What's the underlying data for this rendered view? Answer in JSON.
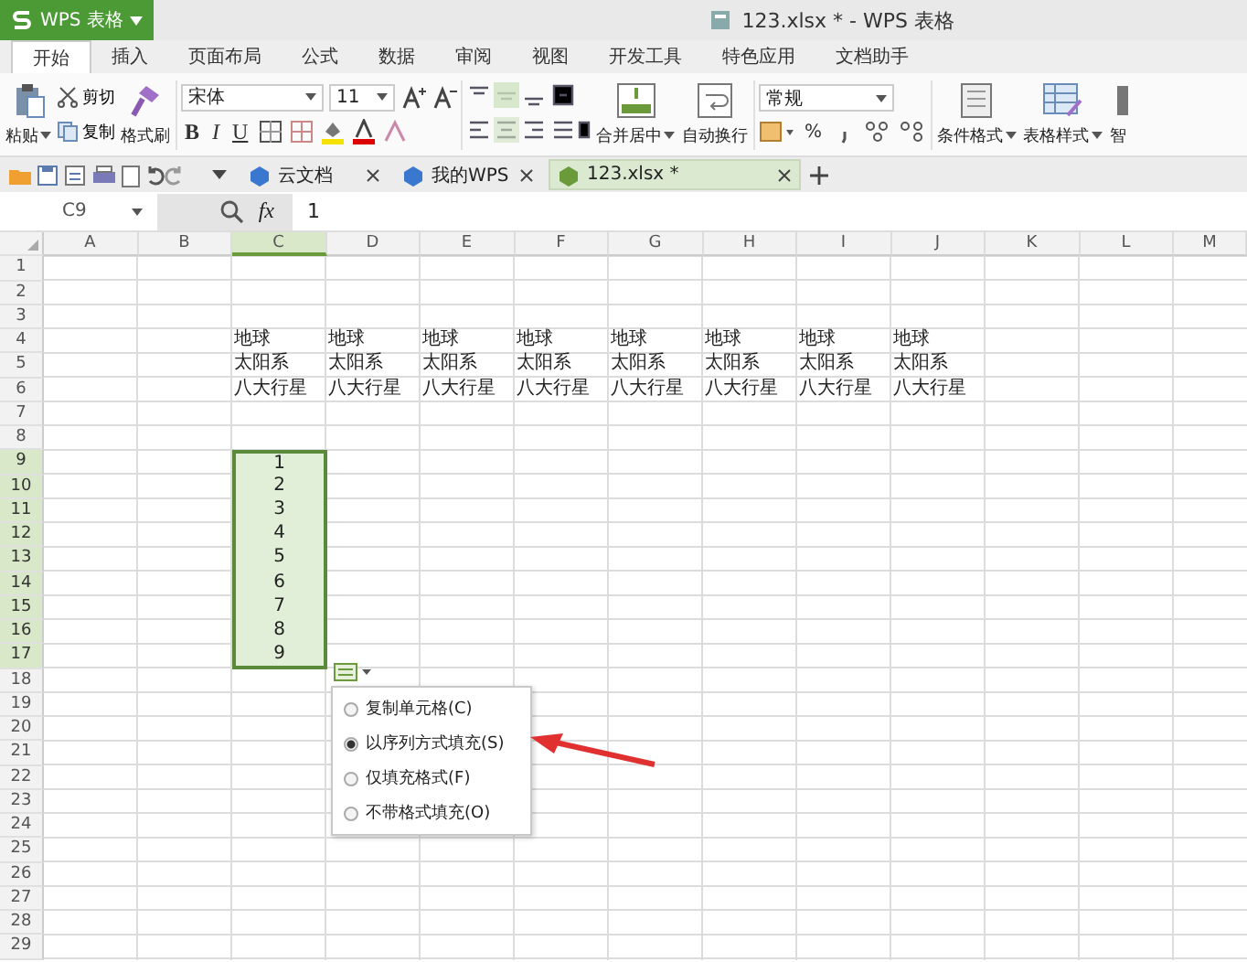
{
  "app_button": {
    "label": "WPS 表格"
  },
  "window": {
    "title": "123.xlsx * - WPS 表格"
  },
  "ribbon_tabs": [
    {
      "label": "开始",
      "selected": true
    },
    {
      "label": "插入",
      "selected": false
    },
    {
      "label": "页面布局",
      "selected": false
    },
    {
      "label": "公式",
      "selected": false
    },
    {
      "label": "数据",
      "selected": false
    },
    {
      "label": "审阅",
      "selected": false
    },
    {
      "label": "视图",
      "selected": false
    },
    {
      "label": "开发工具",
      "selected": false
    },
    {
      "label": "特色应用",
      "selected": false
    },
    {
      "label": "文档助手",
      "selected": false
    }
  ],
  "ribbon": {
    "paste": "粘贴",
    "cut": "剪切",
    "copy": "复制",
    "format_painter": "格式刷",
    "font": "宋体",
    "font_size": "11",
    "bold": "B",
    "italic": "I",
    "underline": "U",
    "merge": "合并居中",
    "wrap": "自动换行",
    "number_format": "常规",
    "percent": "%",
    "conditional_format": "条件格式",
    "table_style": "表格样式",
    "smart": "智"
  },
  "doc_tabs": [
    {
      "label": "云文档",
      "selected": false
    },
    {
      "label": "我的WPS",
      "selected": false
    },
    {
      "label": "123.xlsx *",
      "selected": true
    }
  ],
  "formula_bar": {
    "cell": "C9",
    "fx": "fx",
    "value": "1"
  },
  "columns": [
    {
      "label": "A",
      "selected": false
    },
    {
      "label": "B",
      "selected": false
    },
    {
      "label": "C",
      "selected": true
    },
    {
      "label": "D",
      "selected": false
    },
    {
      "label": "E",
      "selected": false
    },
    {
      "label": "F",
      "selected": false
    },
    {
      "label": "G",
      "selected": false
    },
    {
      "label": "H",
      "selected": false
    },
    {
      "label": "I",
      "selected": false
    },
    {
      "label": "J",
      "selected": false
    },
    {
      "label": "K",
      "selected": false
    },
    {
      "label": "L",
      "selected": false
    },
    {
      "label": "M",
      "selected": false
    }
  ],
  "rows": [
    {
      "label": "1",
      "selected": false
    },
    {
      "label": "2",
      "selected": false
    },
    {
      "label": "3",
      "selected": false
    },
    {
      "label": "4",
      "selected": false,
      "kind": "text",
      "cells": {
        "C": "地球",
        "D": "地球",
        "E": "地球",
        "F": "地球",
        "G": "地球",
        "H": "地球",
        "I": "地球",
        "J": "地球"
      }
    },
    {
      "label": "5",
      "selected": false,
      "kind": "text",
      "cells": {
        "C": "太阳系",
        "D": "太阳系",
        "E": "太阳系",
        "F": "太阳系",
        "G": "太阳系",
        "H": "太阳系",
        "I": "太阳系",
        "J": "太阳系"
      }
    },
    {
      "label": "6",
      "selected": false,
      "kind": "text",
      "cells": {
        "C": "八大行星",
        "D": "八大行星",
        "E": "八大行星",
        "F": "八大行星",
        "G": "八大行星",
        "H": "八大行星",
        "I": "八大行星",
        "J": "八大行星"
      }
    },
    {
      "label": "7",
      "selected": false
    },
    {
      "label": "8",
      "selected": false
    },
    {
      "label": "9",
      "selected": true,
      "kind": "number",
      "cells": {
        "C": "1"
      }
    },
    {
      "label": "10",
      "selected": true,
      "kind": "number",
      "cells": {
        "C": "2"
      }
    },
    {
      "label": "11",
      "selected": true,
      "kind": "number",
      "cells": {
        "C": "3"
      }
    },
    {
      "label": "12",
      "selected": true,
      "kind": "number",
      "cells": {
        "C": "4"
      }
    },
    {
      "label": "13",
      "selected": true,
      "kind": "number",
      "cells": {
        "C": "5"
      }
    },
    {
      "label": "14",
      "selected": true,
      "kind": "number",
      "cells": {
        "C": "6"
      }
    },
    {
      "label": "15",
      "selected": true,
      "kind": "number",
      "cells": {
        "C": "7"
      }
    },
    {
      "label": "16",
      "selected": true,
      "kind": "number",
      "cells": {
        "C": "8"
      }
    },
    {
      "label": "17",
      "selected": true,
      "kind": "number",
      "cells": {
        "C": "9"
      }
    },
    {
      "label": "18",
      "selected": false
    },
    {
      "label": "19",
      "selected": false
    },
    {
      "label": "20",
      "selected": false
    },
    {
      "label": "21",
      "selected": false
    },
    {
      "label": "22",
      "selected": false
    },
    {
      "label": "23",
      "selected": false
    },
    {
      "label": "24",
      "selected": false
    },
    {
      "label": "25",
      "selected": false
    },
    {
      "label": "26",
      "selected": false
    },
    {
      "label": "27",
      "selected": false
    },
    {
      "label": "28",
      "selected": false
    },
    {
      "label": "29",
      "selected": false
    }
  ],
  "fill_menu": {
    "options": [
      {
        "label": "复制单元格(C)",
        "selected": false
      },
      {
        "label": "以序列方式填充(S)",
        "selected": true
      },
      {
        "label": "仅填充格式(F)",
        "selected": false
      },
      {
        "label": "不带格式填充(O)",
        "selected": false
      }
    ]
  }
}
